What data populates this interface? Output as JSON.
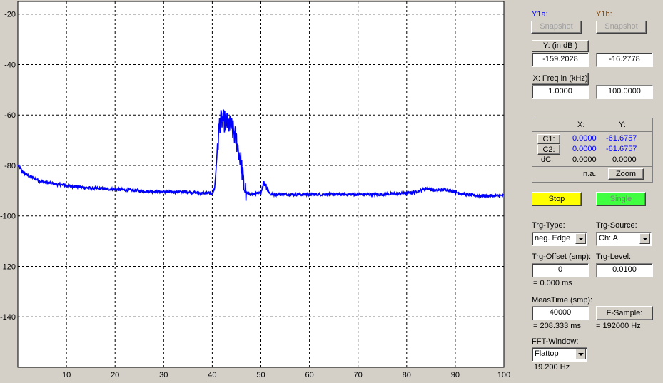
{
  "plot": {
    "y_ticks": [
      "-20",
      "-40",
      "-60",
      "-80",
      "-100",
      "-120",
      "-140"
    ],
    "x_ticks": [
      "10",
      "20",
      "30",
      "40",
      "50",
      "60",
      "70",
      "80",
      "90",
      "100"
    ],
    "trace_color": "#0000ff",
    "background": "#ffffff",
    "grid": "dashed"
  },
  "chart_data": {
    "type": "line",
    "xlim": [
      0,
      100
    ],
    "ylim": [
      -160,
      -15
    ],
    "grid": true,
    "x": [
      0,
      1,
      2,
      5,
      10,
      15,
      20,
      25,
      30,
      35,
      38,
      40,
      40.5,
      41,
      41.5,
      42,
      43,
      44,
      45,
      46,
      46.5,
      47,
      48,
      50,
      50.5,
      51,
      51.5,
      52,
      55,
      60,
      65,
      70,
      75,
      80,
      82,
      84,
      86,
      88,
      90,
      92,
      95,
      100
    ],
    "y": [
      -80,
      -82.5,
      -84,
      -86.5,
      -88,
      -89,
      -89.5,
      -90,
      -90.5,
      -90.5,
      -91,
      -91,
      -89,
      -75,
      -63,
      -62,
      -63,
      -65,
      -70,
      -80,
      -88,
      -91,
      -91.5,
      -91,
      -87,
      -87.5,
      -90,
      -91.5,
      -91.5,
      -91.5,
      -91.5,
      -91.5,
      -91.5,
      -91,
      -90.5,
      -89,
      -90,
      -89.5,
      -90.5,
      -91.5,
      -92,
      -92
    ]
  },
  "panel": {
    "y1a_label": "Y1a:",
    "y1b_label": "Y1b:",
    "y1a_color": "#0000ff",
    "y1b_color": "#804000",
    "snapshot_a": "Snapshot",
    "snapshot_b": "Snapshot",
    "y_button": "Y: (in dB )",
    "y_min": "-159.2028",
    "y_max": "-16.2778",
    "x_button": "X: Freq in (kHz)",
    "x_min": "1.0000",
    "x_max": "100.0000",
    "cursor": {
      "col_x": "X:",
      "col_y": "Y:",
      "c1_label": "C1:",
      "c1_x": "0.0000",
      "c1_y": "-61.6757",
      "c2_label": "C2:",
      "c2_x": "0.0000",
      "c2_y": "-61.6757",
      "dc_label": "dC:",
      "dc_x": "0.0000",
      "dc_y": "0.0000",
      "na": "n.a.",
      "zoom": "Zoom"
    },
    "stop": "Stop",
    "stop_color": "#ffff00",
    "single": "Single",
    "single_color": "#40ff40",
    "trg_type_label": "Trg-Type:",
    "trg_type_value": "neg. Edge",
    "trg_source_label": "Trg-Source:",
    "trg_source_value": "Ch: A",
    "trg_offset_label": "Trg-Offset (smp):",
    "trg_offset_value": "0",
    "trg_offset_ms": "= 0.000 ms",
    "trg_level_label": "Trg-Level:",
    "trg_level_value": "0.0100",
    "meastime_label": "MeasTime (smp):",
    "meastime_value": "40000",
    "meastime_ms": "= 208.333 ms",
    "fsample_button": "F-Sample:",
    "fsample_value": "= 192000 Hz",
    "fft_label": "FFT-Window:",
    "fft_value": "Flattop",
    "fft_res": "19.200 Hz"
  }
}
